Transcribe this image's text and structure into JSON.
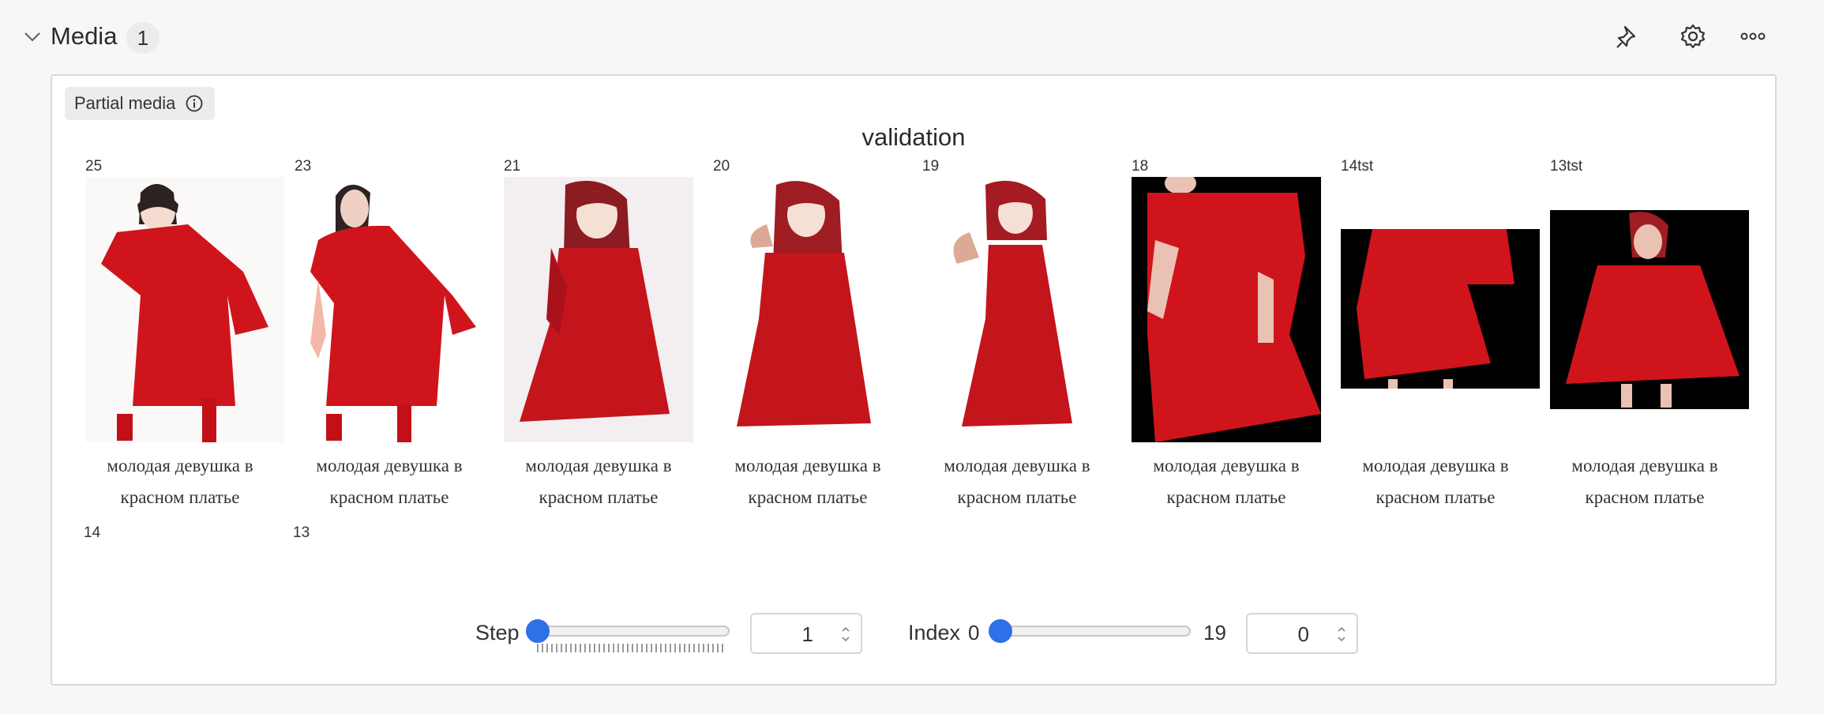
{
  "header": {
    "title": "Media",
    "count": "1",
    "icons": [
      "chevron-down-icon",
      "pin-icon",
      "gear-icon",
      "more-icon"
    ]
  },
  "panel": {
    "partial_label": "Partial media",
    "section_title": "validation",
    "cells": [
      {
        "label": "25",
        "caption_line1": "молодая девушка в",
        "caption_line2": "красном платье"
      },
      {
        "label": "23",
        "caption_line1": "молодая девушка в",
        "caption_line2": "красном платье"
      },
      {
        "label": "21",
        "caption_line1": "молодая девушка в",
        "caption_line2": "красном платье"
      },
      {
        "label": "20",
        "caption_line1": "молодая девушка в",
        "caption_line2": "красном платье"
      },
      {
        "label": "19",
        "caption_line1": "молодая девушка в",
        "caption_line2": "красном платье"
      },
      {
        "label": "18",
        "caption_line1": "молодая девушка в",
        "caption_line2": "красном платье"
      },
      {
        "label": "14tst",
        "caption_line1": "молодая девушка в",
        "caption_line2": "красном платье"
      },
      {
        "label": "13tst",
        "caption_line1": "молодая девушка в",
        "caption_line2": "красном платье"
      }
    ],
    "row2_labels": [
      "14",
      "13"
    ]
  },
  "controls": {
    "step_label": "Step",
    "step_value": "1",
    "step_fraction": 0,
    "index_label": "Index",
    "index_min": "0",
    "index_max": "19",
    "index_value": "0",
    "index_fraction": 0
  },
  "colors": {
    "accent": "#2f6fe8",
    "dress_red": "#d0141c",
    "background": "#f7f7f7"
  }
}
